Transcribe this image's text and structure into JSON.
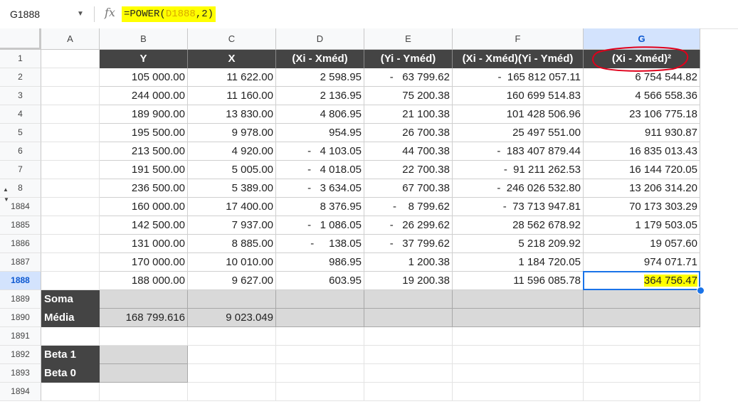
{
  "formula_bar": {
    "name_box": "G1888",
    "fx_label": "fx",
    "formula_prefix": "=POWER(",
    "formula_ref": "D1888",
    "formula_suffix": ",2)"
  },
  "columns": [
    "A",
    "B",
    "C",
    "D",
    "E",
    "F",
    "G"
  ],
  "selected_column": "G",
  "rows": [
    "1",
    "2",
    "3",
    "4",
    "5",
    "6",
    "7",
    "8",
    "1884",
    "1885",
    "1886",
    "1887",
    "1888",
    "1889",
    "1890",
    "1891",
    "1892",
    "1893",
    "1894"
  ],
  "selected_row": "1888",
  "table": {
    "headers": [
      "Y",
      "X",
      "(Xi - Xméd)",
      "(Yi - Yméd)",
      "(Xi - Xméd)(Yi - Yméd)",
      "(Xi - Xméd)²"
    ],
    "data": [
      [
        "105 000.00",
        "11 622.00",
        "2 598.95",
        "-   63 799.62",
        "-  165 812 057.11",
        "6 754 544.82"
      ],
      [
        "244 000.00",
        "11 160.00",
        "2 136.95",
        "75 200.38",
        "160 699 514.83",
        "4 566 558.36"
      ],
      [
        "189 900.00",
        "13 830.00",
        "4 806.95",
        "21 100.38",
        "101 428 506.96",
        "23 106 775.18"
      ],
      [
        "195 500.00",
        "9 978.00",
        "954.95",
        "26 700.38",
        "25 497 551.00",
        "911 930.87"
      ],
      [
        "213 500.00",
        "4 920.00",
        "-   4 103.05",
        "44 700.38",
        "-  183 407 879.44",
        "16 835 013.43"
      ],
      [
        "191 500.00",
        "5 005.00",
        "-   4 018.05",
        "22 700.38",
        "-  91 211 262.53",
        "16 144 720.05"
      ],
      [
        "236 500.00",
        "5 389.00",
        "-   3 634.05",
        "67 700.38",
        "-  246 026 532.80",
        "13 206 314.20"
      ],
      [
        "160 000.00",
        "17 400.00",
        "8 376.95",
        "-    8 799.62",
        "-  73 713 947.81",
        "70 173 303.29"
      ],
      [
        "142 500.00",
        "7 937.00",
        "-   1 086.05",
        "-   26 299.62",
        "28 562 678.92",
        "1 179 503.05"
      ],
      [
        "131 000.00",
        "8 885.00",
        "-     138.05",
        "-   37 799.62",
        "5 218 209.92",
        "19 057.60"
      ],
      [
        "170 000.00",
        "10 010.00",
        "986.95",
        "1 200.38",
        "1 184 720.05",
        "974 071.71"
      ],
      [
        "188 000.00",
        "9 627.00",
        "603.95",
        "19 200.38",
        "11 596 085.78",
        "364 756.47"
      ]
    ],
    "soma_label": "Soma",
    "media_label": "Média",
    "media_values": [
      "168 799.616",
      "9 023.049"
    ],
    "beta1_label": "Beta 1",
    "beta0_label": "Beta 0"
  },
  "colors": {
    "header_bg": "#444444",
    "highlight": "#ffff00",
    "selection": "#1a73e8",
    "annotation": "#e0001b"
  }
}
